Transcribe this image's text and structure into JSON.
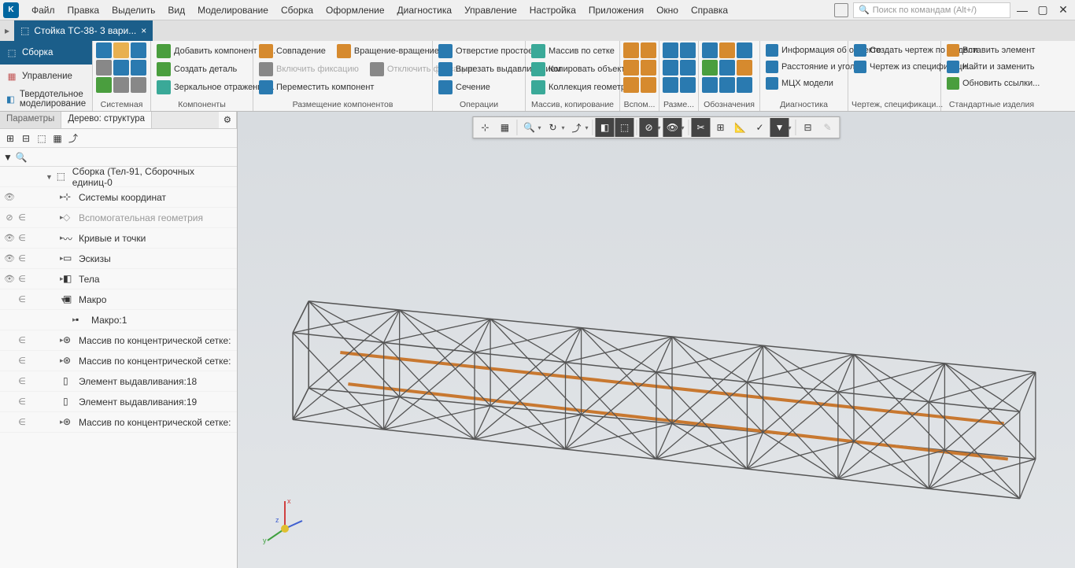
{
  "menu": {
    "items": [
      "Файл",
      "Правка",
      "Выделить",
      "Вид",
      "Моделирование",
      "Сборка",
      "Оформление",
      "Диагностика",
      "Управление",
      "Настройка",
      "Приложения",
      "Окно",
      "Справка"
    ],
    "search_placeholder": "Поиск по командам (Alt+/)"
  },
  "tab": {
    "title": "Стойка ТС-38- 3 вари..."
  },
  "ribbon_left": {
    "tabs": [
      "Сборка",
      "Управление",
      "Твердотельное моделирование"
    ]
  },
  "ribbon": {
    "sys_label": "Системная",
    "comp": {
      "add": "Добавить компонент из...",
      "create": "Создать деталь",
      "mirror": "Зеркальное отражение...",
      "label": "Компоненты"
    },
    "place": {
      "coincide": "Совпадение",
      "enable_fix": "Включить фиксацию",
      "rotation": "Вращение-вращение",
      "disable_fix": "Отключить фиксацию",
      "move": "Переместить компонент",
      "label": "Размещение компонентов"
    },
    "ops": {
      "hole": "Отверстие простое",
      "cut": "Вырезать выдавливанием",
      "section": "Сечение",
      "label": "Операции"
    },
    "array": {
      "grid": "Массив по сетке",
      "copy": "Копировать объекты",
      "geom": "Коллекция геометрии",
      "label": "Массив, копирование"
    },
    "aux_label": "Вспом...",
    "dim_label": "Разме...",
    "notation_label": "Обозначения",
    "diag": {
      "info": "Информация об объекте",
      "dist": "Расстояние и угол",
      "mass": "МЦХ модели",
      "label": "Диагностика"
    },
    "draw": {
      "create": "Создать чертеж по модели",
      "spec": "Чертеж из спецификаци...",
      "label": "Чертеж, спецификаци..."
    },
    "std": {
      "insert": "Вставить элемент",
      "find": "Найти и заменить",
      "update": "Обновить ссылки...",
      "label": "Стандартные изделия"
    }
  },
  "panel": {
    "tab1": "Параметры",
    "tab2": "Дерево: структура"
  },
  "tree": {
    "root": "Сборка (Тел-91, Сборочных единиц-0",
    "items": [
      "Системы координат",
      "Вспомогательная геометрия",
      "Кривые и точки",
      "Эскизы",
      "Тела",
      "Макро",
      "Макро:1",
      "Массив по концентрической сетке:",
      "Массив по концентрической сетке:",
      "Элемент выдавливания:18",
      "Элемент выдавливания:19",
      "Массив по концентрической сетке:"
    ]
  }
}
